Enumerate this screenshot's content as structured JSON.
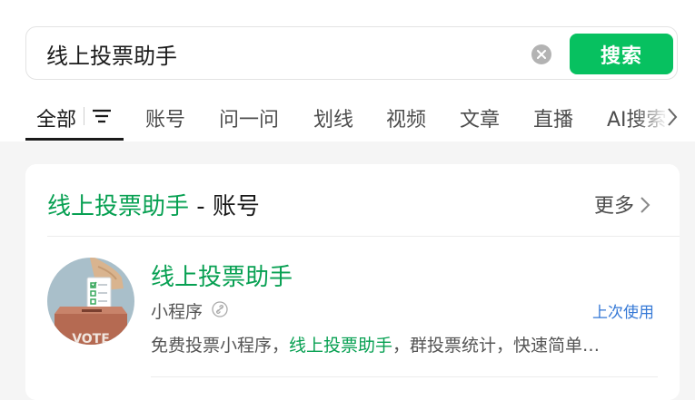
{
  "search": {
    "query": "线上投票助手",
    "button_label": "搜索"
  },
  "tabs": [
    {
      "label": "全部"
    },
    {
      "label": "账号"
    },
    {
      "label": "问一问"
    },
    {
      "label": "划线"
    },
    {
      "label": "视频"
    },
    {
      "label": "文章"
    },
    {
      "label": "直播"
    },
    {
      "label": "AI搜索"
    }
  ],
  "active_tab": "全部",
  "section": {
    "title_highlight": "线上投票助手",
    "title_rest": " - 账号",
    "more_label": "更多"
  },
  "result": {
    "name": "线上投票助手",
    "type": "小程序",
    "recent_tag": "上次使用",
    "desc_before": "免费投票小程序，",
    "desc_highlight": "线上投票助手",
    "desc_after": "，群投票统计，快速简单…",
    "avatar_icon": "ballot-box-icon"
  },
  "colors": {
    "brand_green": "#07c160",
    "highlight_green": "#07a052",
    "link_blue": "#3478d6"
  }
}
